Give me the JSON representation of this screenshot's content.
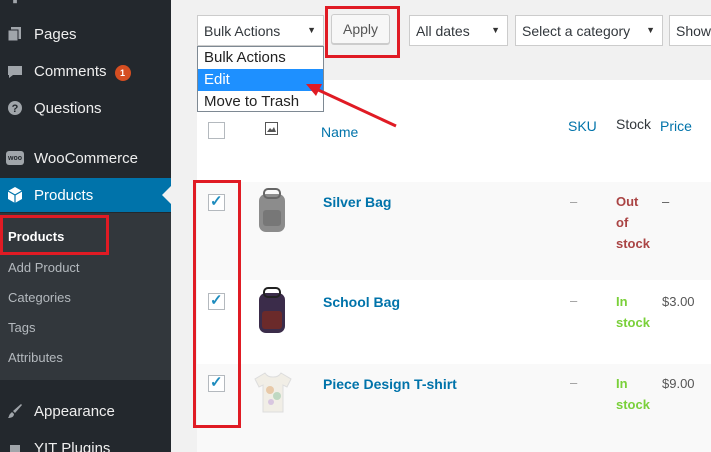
{
  "sidebar": {
    "pages": "Pages",
    "comments": "Comments",
    "comments_badge": "1",
    "questions": "Questions",
    "woocommerce": "WooCommerce",
    "woo_logo": "woo",
    "products": "Products",
    "submenu": [
      "Products",
      "Add Product",
      "Categories",
      "Tags",
      "Attributes"
    ],
    "appearance": "Appearance",
    "plugins": "YIT Plugins"
  },
  "toolbar": {
    "bulk_actions": "Bulk Actions",
    "apply": "Apply",
    "dates": "All dates",
    "category": "Select a category",
    "show": "Show"
  },
  "bulk_dropdown": {
    "options": [
      "Bulk Actions",
      "Edit",
      "Move to Trash"
    ],
    "selected": "Edit"
  },
  "table": {
    "columns": {
      "name": "Name",
      "sku": "SKU",
      "stock": "Stock",
      "price": "Price"
    },
    "rows": [
      {
        "name": "Silver Bag",
        "sku": "–",
        "stock": "Out of stock",
        "price": "–",
        "checked": true
      },
      {
        "name": "School Bag",
        "sku": "–",
        "stock": "In stock",
        "price": "$3.00",
        "checked": true
      },
      {
        "name": "Piece Design T-shirt",
        "sku": "–",
        "stock": "In stock",
        "price": "$9.00",
        "checked": true
      }
    ]
  },
  "colors": {
    "sidebar_bg": "#23282d",
    "active": "#0073aa",
    "highlight": "#e01b24",
    "in_stock": "#7ad03a",
    "out_of_stock": "#a44444"
  }
}
